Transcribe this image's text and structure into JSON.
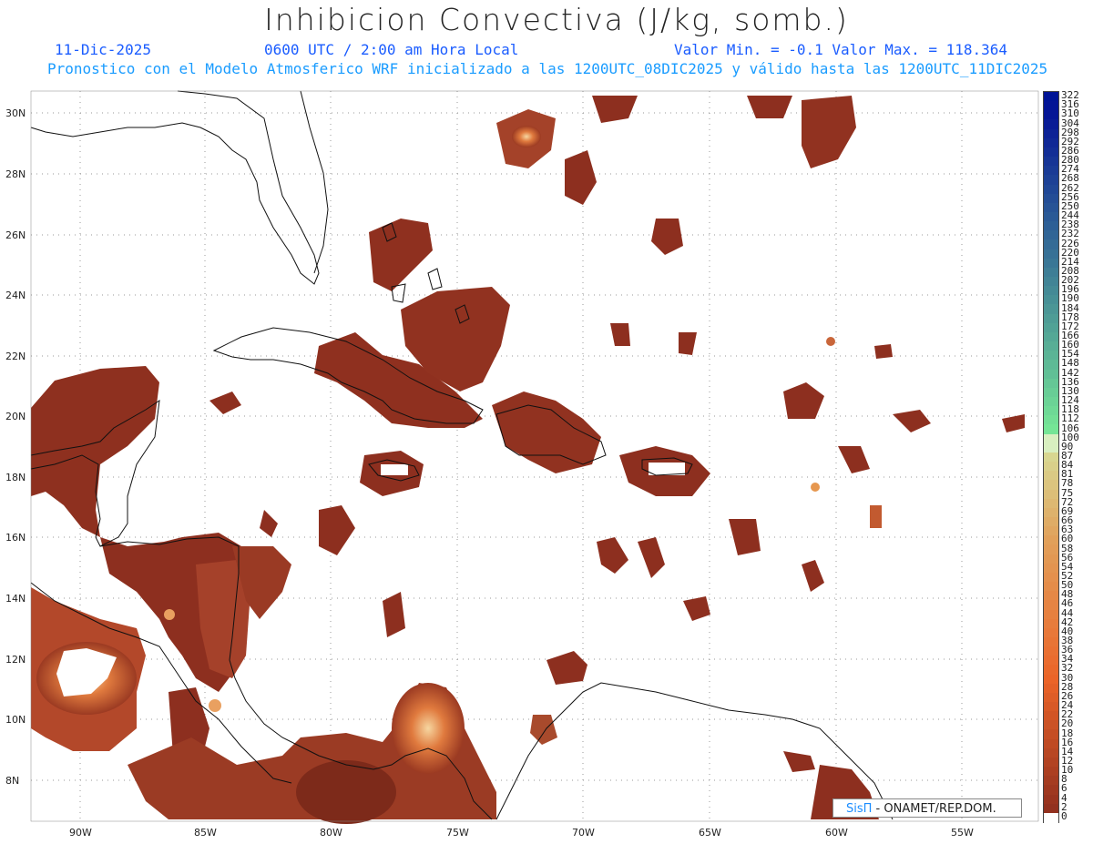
{
  "header": {
    "title": "Inhibicion Convectiva (J/kg, somb.)",
    "date": "11-Dic-2025",
    "time": "0600 UTC / 2:00 am Hora Local",
    "minmax": "Valor Min. = -0.1  Valor Max. = 118.364",
    "model": "Pronostico con el Modelo Atmosferico WRF inicializado a las 1200UTC_08DIC2025 y válido hasta las  1200UTC_11DIC2025"
  },
  "axes": {
    "lat_labels": [
      "30N",
      "28N",
      "26N",
      "24N",
      "22N",
      "20N",
      "18N",
      "16N",
      "14N",
      "12N",
      "10N",
      "8N"
    ],
    "lon_labels": [
      "90W",
      "85W",
      "80W",
      "75W",
      "70W",
      "65W",
      "60W",
      "55W"
    ]
  },
  "legend": {
    "labels": [
      "322",
      "316",
      "310",
      "304",
      "298",
      "292",
      "286",
      "280",
      "274",
      "268",
      "262",
      "256",
      "250",
      "244",
      "238",
      "232",
      "226",
      "220",
      "214",
      "208",
      "202",
      "196",
      "190",
      "184",
      "178",
      "172",
      "166",
      "160",
      "154",
      "148",
      "142",
      "136",
      "130",
      "124",
      "118",
      "112",
      "106",
      "100",
      "90",
      "87",
      "84",
      "81",
      "78",
      "75",
      "72",
      "69",
      "66",
      "63",
      "60",
      "58",
      "56",
      "54",
      "52",
      "50",
      "48",
      "46",
      "44",
      "42",
      "40",
      "38",
      "36",
      "34",
      "32",
      "30",
      "28",
      "26",
      "24",
      "22",
      "20",
      "18",
      "16",
      "14",
      "12",
      "10",
      "8",
      "6",
      "4",
      "2",
      "0"
    ]
  },
  "credit": {
    "brand": "SisΠ",
    "text": " - ONAMET/REP.DOM."
  },
  "colors": {
    "field_dark": "#8b2f1e",
    "field_mid": "#b5482a",
    "field_hot": "#e8864a",
    "coast": "#111111",
    "grid": "#999999",
    "title_blue": "#1a5cff",
    "model_blue": "#1a9cff"
  }
}
